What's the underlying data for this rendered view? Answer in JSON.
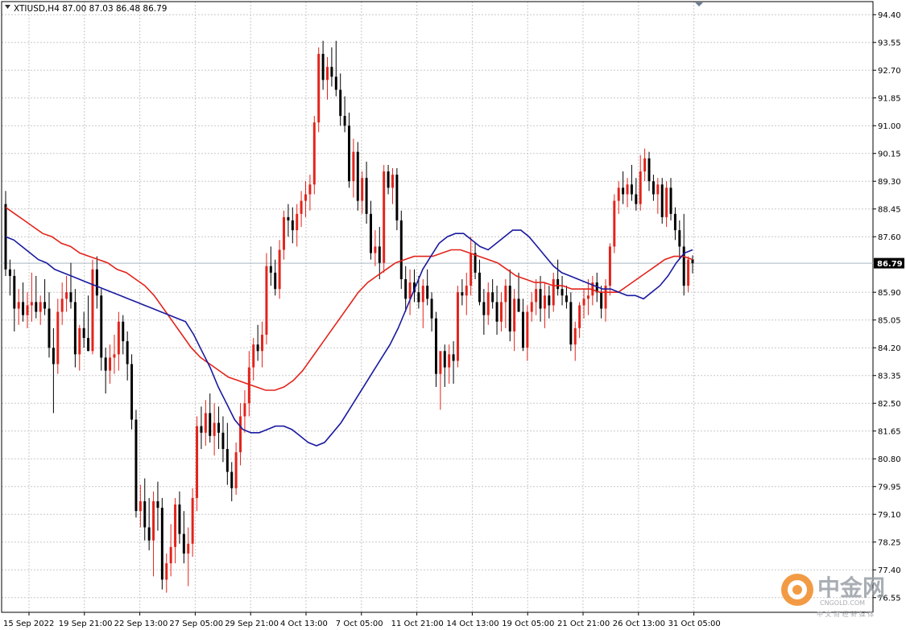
{
  "header": {
    "text": "XTIUSD,H4  87.00 87.03 86.48 86.79"
  },
  "price_tag": "86.79",
  "watermark": {
    "name": "中金网",
    "domain": "CNGOLD.COM",
    "tagline": "中 文 财 经 新 媒 体"
  },
  "colors": {
    "bull": "#e3231b",
    "bear": "#000000",
    "ma_fast": "#1a1aa0",
    "ma_slow": "#e3231b",
    "grid": "#c8c8c8",
    "price_line": "#aab8c2"
  },
  "chart_data": {
    "type": "candlestick",
    "symbol": "XTIUSD",
    "timeframe": "H4",
    "ylim": [
      76.1,
      94.8
    ],
    "y_ticks": [
      "94.40",
      "93.55",
      "92.70",
      "91.85",
      "91.00",
      "90.15",
      "89.30",
      "88.45",
      "87.60",
      "86.79",
      "85.90",
      "85.05",
      "84.20",
      "83.35",
      "82.50",
      "81.65",
      "80.80",
      "79.95",
      "79.10",
      "78.25",
      "77.40",
      "76.55"
    ],
    "x_labels": [
      "15 Sep 2022",
      "19 Sep 21:00",
      "22 Sep 13:00",
      "27 Sep 05:00",
      "29 Sep 21:00",
      "4 Oct 13:00",
      "7 Oct 05:00",
      "11 Oct 21:00",
      "14 Oct 13:00",
      "19 Oct 05:00",
      "21 Oct 21:00",
      "26 Oct 13:00",
      "31 Oct 05:00"
    ],
    "last_price": 86.79,
    "grid": true,
    "series": [
      {
        "name": "",
        "type": "candles",
        "ohlc": [
          [
            88.6,
            89.0,
            86.4,
            86.6
          ],
          [
            86.6,
            86.9,
            85.8,
            86.4
          ],
          [
            86.4,
            86.6,
            84.7,
            85.4
          ],
          [
            85.4,
            86.0,
            84.9,
            85.6
          ],
          [
            85.6,
            86.2,
            85.0,
            85.2
          ],
          [
            85.2,
            85.9,
            84.8,
            85.5
          ],
          [
            85.5,
            86.5,
            85.0,
            85.6
          ],
          [
            85.6,
            86.4,
            85.1,
            85.3
          ],
          [
            85.3,
            85.8,
            84.9,
            85.6
          ],
          [
            85.6,
            86.3,
            85.2,
            85.4
          ],
          [
            85.4,
            85.9,
            83.9,
            84.2
          ],
          [
            84.2,
            84.8,
            82.2,
            83.7
          ],
          [
            83.7,
            85.7,
            83.4,
            85.3
          ],
          [
            85.3,
            86.2,
            84.9,
            85.7
          ],
          [
            85.7,
            86.4,
            85.3,
            85.9
          ],
          [
            85.9,
            86.8,
            85.4,
            85.6
          ],
          [
            85.6,
            86.0,
            83.6,
            84.0
          ],
          [
            84.0,
            84.9,
            83.5,
            84.8
          ],
          [
            84.8,
            85.3,
            84.2,
            84.5
          ],
          [
            84.5,
            85.8,
            84.1,
            84.1
          ],
          [
            84.1,
            86.9,
            84.0,
            86.6
          ],
          [
            86.6,
            87.0,
            85.4,
            85.8
          ],
          [
            85.8,
            86.0,
            83.5,
            83.9
          ],
          [
            83.9,
            84.2,
            82.8,
            83.5
          ],
          [
            83.5,
            84.3,
            83.1,
            83.9
          ],
          [
            83.9,
            84.6,
            83.4,
            84.0
          ],
          [
            84.0,
            85.3,
            83.5,
            85.0
          ],
          [
            85.0,
            85.2,
            84.0,
            84.4
          ],
          [
            84.4,
            84.7,
            83.2,
            83.7
          ],
          [
            83.7,
            84.0,
            81.7,
            82.0
          ],
          [
            82.0,
            82.3,
            79.0,
            79.2
          ],
          [
            79.2,
            80.0,
            78.7,
            79.5
          ],
          [
            79.5,
            80.2,
            78.3,
            78.7
          ],
          [
            78.7,
            79.6,
            78.0,
            78.3
          ],
          [
            78.3,
            79.8,
            77.2,
            79.5
          ],
          [
            79.5,
            80.1,
            78.6,
            79.3
          ],
          [
            79.3,
            79.6,
            76.8,
            77.1
          ],
          [
            77.1,
            77.9,
            76.7,
            77.6
          ],
          [
            77.6,
            78.8,
            77.2,
            78.1
          ],
          [
            78.1,
            79.6,
            77.6,
            79.4
          ],
          [
            79.4,
            79.8,
            78.2,
            78.5
          ],
          [
            78.5,
            79.2,
            77.6,
            77.9
          ],
          [
            77.9,
            78.7,
            76.9,
            78.2
          ],
          [
            78.2,
            79.9,
            77.8,
            79.6
          ],
          [
            79.6,
            82.1,
            79.2,
            81.8
          ],
          [
            81.8,
            82.4,
            81.1,
            81.6
          ],
          [
            81.6,
            82.6,
            81.2,
            82.2
          ],
          [
            82.2,
            82.8,
            81.3,
            81.5
          ],
          [
            81.5,
            82.5,
            80.9,
            81.9
          ],
          [
            81.9,
            82.4,
            81.1,
            81.6
          ],
          [
            81.6,
            82.1,
            80.7,
            81.1
          ],
          [
            81.1,
            81.9,
            80.0,
            80.4
          ],
          [
            80.4,
            80.7,
            79.5,
            79.9
          ],
          [
            79.9,
            81.3,
            79.7,
            81.0
          ],
          [
            81.0,
            82.5,
            80.6,
            82.1
          ],
          [
            82.1,
            82.9,
            81.6,
            82.5
          ],
          [
            82.5,
            84.1,
            82.1,
            83.6
          ],
          [
            83.6,
            84.5,
            83.2,
            84.3
          ],
          [
            84.3,
            84.9,
            83.8,
            84.1
          ],
          [
            84.1,
            85.0,
            83.6,
            84.6
          ],
          [
            84.6,
            87.1,
            84.3,
            86.7
          ],
          [
            86.7,
            87.3,
            86.1,
            86.5
          ],
          [
            86.5,
            86.9,
            85.8,
            86.0
          ],
          [
            86.0,
            87.5,
            85.7,
            87.2
          ],
          [
            87.2,
            88.4,
            86.9,
            88.2
          ],
          [
            88.2,
            88.6,
            87.6,
            88.1
          ],
          [
            88.1,
            88.5,
            87.4,
            87.8
          ],
          [
            87.8,
            88.6,
            87.3,
            88.3
          ],
          [
            88.3,
            89.0,
            87.9,
            88.7
          ],
          [
            88.7,
            89.3,
            88.2,
            88.9
          ],
          [
            88.9,
            89.5,
            88.4,
            89.2
          ],
          [
            89.2,
            91.3,
            88.9,
            91.1
          ],
          [
            91.1,
            93.4,
            90.8,
            93.2
          ],
          [
            93.2,
            93.6,
            92.1,
            92.4
          ],
          [
            92.4,
            93.1,
            91.8,
            92.8
          ],
          [
            92.8,
            93.4,
            92.2,
            92.5
          ],
          [
            92.5,
            93.6,
            91.9,
            92.1
          ],
          [
            92.1,
            92.6,
            91.0,
            91.3
          ],
          [
            91.3,
            91.9,
            90.8,
            91.0
          ],
          [
            91.0,
            91.4,
            89.1,
            89.3
          ],
          [
            89.3,
            90.6,
            88.8,
            90.2
          ],
          [
            90.2,
            90.5,
            88.4,
            88.7
          ],
          [
            88.7,
            89.6,
            88.3,
            89.4
          ],
          [
            89.4,
            89.9,
            88.0,
            88.3
          ],
          [
            88.3,
            88.7,
            86.9,
            87.1
          ],
          [
            87.1,
            87.8,
            86.7,
            87.3
          ],
          [
            87.3,
            87.9,
            86.3,
            86.8
          ],
          [
            86.8,
            89.8,
            86.5,
            89.6
          ],
          [
            89.6,
            89.8,
            88.9,
            89.1
          ],
          [
            89.1,
            89.7,
            88.6,
            89.5
          ],
          [
            89.5,
            89.7,
            87.8,
            88.1
          ],
          [
            88.1,
            88.4,
            86.0,
            86.3
          ],
          [
            86.3,
            86.7,
            85.3,
            85.7
          ],
          [
            85.7,
            86.6,
            85.2,
            86.2
          ],
          [
            86.2,
            86.6,
            85.6,
            85.9
          ],
          [
            85.9,
            86.4,
            85.4,
            85.6
          ],
          [
            85.6,
            86.3,
            84.8,
            86.1
          ],
          [
            86.1,
            86.6,
            85.5,
            85.7
          ],
          [
            85.7,
            85.9,
            84.7,
            85.1
          ],
          [
            85.1,
            85.3,
            83.0,
            83.4
          ],
          [
            83.4,
            84.0,
            82.3,
            84.1
          ],
          [
            84.1,
            84.3,
            83.0,
            83.6
          ],
          [
            83.6,
            84.3,
            83.1,
            84.0
          ],
          [
            84.0,
            84.4,
            83.1,
            83.8
          ],
          [
            83.8,
            86.1,
            83.6,
            85.9
          ],
          [
            85.9,
            86.3,
            85.5,
            85.8
          ],
          [
            85.8,
            86.5,
            85.2,
            86.1
          ],
          [
            86.1,
            87.6,
            85.8,
            87.1
          ],
          [
            87.1,
            87.4,
            86.3,
            86.5
          ],
          [
            86.5,
            86.9,
            85.5,
            85.6
          ],
          [
            85.6,
            86.0,
            84.6,
            85.2
          ],
          [
            85.2,
            86.2,
            84.9,
            85.9
          ],
          [
            85.9,
            86.3,
            85.4,
            85.6
          ],
          [
            85.6,
            86.1,
            84.6,
            85.0
          ],
          [
            85.0,
            85.9,
            84.7,
            85.6
          ],
          [
            85.6,
            86.3,
            84.8,
            86.1
          ],
          [
            86.1,
            86.6,
            84.4,
            84.7
          ],
          [
            84.7,
            86.0,
            84.1,
            85.7
          ],
          [
            85.7,
            86.5,
            85.3,
            85.3
          ],
          [
            85.3,
            85.7,
            84.1,
            84.2
          ],
          [
            84.2,
            85.5,
            83.8,
            85.3
          ],
          [
            85.3,
            85.9,
            85.0,
            85.6
          ],
          [
            85.6,
            86.3,
            85.2,
            86.0
          ],
          [
            86.0,
            86.4,
            85.0,
            85.4
          ],
          [
            85.4,
            86.2,
            84.8,
            85.8
          ],
          [
            85.8,
            86.1,
            85.1,
            85.5
          ],
          [
            85.5,
            86.5,
            85.3,
            86.3
          ],
          [
            86.3,
            86.9,
            85.8,
            86.0
          ],
          [
            86.0,
            86.4,
            85.5,
            85.8
          ],
          [
            85.8,
            86.1,
            85.4,
            85.6
          ],
          [
            85.6,
            85.9,
            84.1,
            84.3
          ],
          [
            84.3,
            85.0,
            83.8,
            84.8
          ],
          [
            84.8,
            85.6,
            84.5,
            85.5
          ],
          [
            85.5,
            86.0,
            85.1,
            85.7
          ],
          [
            85.7,
            86.3,
            85.2,
            85.8
          ],
          [
            85.8,
            86.4,
            85.5,
            86.2
          ],
          [
            86.2,
            86.5,
            85.6,
            85.9
          ],
          [
            85.9,
            86.1,
            85.1,
            85.4
          ],
          [
            85.4,
            86.3,
            85.0,
            86.1
          ],
          [
            86.1,
            87.4,
            85.8,
            87.3
          ],
          [
            87.3,
            88.9,
            87.1,
            88.7
          ],
          [
            88.7,
            89.3,
            88.3,
            89.1
          ],
          [
            89.1,
            89.6,
            88.6,
            88.9
          ],
          [
            88.9,
            89.4,
            88.5,
            89.2
          ],
          [
            89.2,
            89.8,
            88.7,
            88.9
          ],
          [
            88.9,
            89.4,
            88.4,
            88.6
          ],
          [
            88.6,
            90.1,
            88.4,
            89.6
          ],
          [
            89.6,
            90.3,
            89.3,
            90.0
          ],
          [
            90.0,
            90.2,
            89.0,
            89.3
          ],
          [
            89.3,
            89.5,
            88.7,
            88.9
          ],
          [
            88.9,
            89.4,
            88.3,
            89.2
          ],
          [
            89.2,
            89.4,
            88.0,
            88.2
          ],
          [
            88.2,
            89.3,
            87.9,
            89.1
          ],
          [
            89.1,
            89.4,
            88.1,
            88.3
          ],
          [
            88.3,
            88.5,
            87.5,
            87.8
          ],
          [
            87.8,
            88.1,
            86.9,
            87.3
          ],
          [
            87.3,
            88.3,
            85.8,
            86.1
          ],
          [
            86.1,
            87.0,
            85.9,
            86.9
          ],
          [
            86.9,
            87.03,
            86.48,
            86.79
          ]
        ]
      },
      {
        "name": "",
        "type": "line",
        "values": [
          87.6,
          87.5,
          87.3,
          87.1,
          86.9,
          86.8,
          86.6,
          86.5,
          86.4,
          86.3,
          86.2,
          86.1,
          86.0,
          85.9,
          85.8,
          85.7,
          85.6,
          85.5,
          85.4,
          85.3,
          85.2,
          85.1,
          85.0,
          84.6,
          84.1,
          83.6,
          83.0,
          82.5,
          82.0,
          81.7,
          81.6,
          81.6,
          81.7,
          81.8,
          81.8,
          81.7,
          81.5,
          81.3,
          81.2,
          81.3,
          81.6,
          81.9,
          82.3,
          82.7,
          83.1,
          83.5,
          83.9,
          84.3,
          84.8,
          85.4,
          86.0,
          86.6,
          87.0,
          87.4,
          87.6,
          87.7,
          87.7,
          87.5,
          87.3,
          87.2,
          87.4,
          87.6,
          87.8,
          87.8,
          87.6,
          87.3,
          87.0,
          86.7,
          86.5,
          86.4,
          86.3,
          86.2,
          86.1,
          86.0,
          86.0,
          85.9,
          85.8,
          85.8,
          85.7,
          85.9,
          86.1,
          86.4,
          86.8,
          87.1,
          87.2
        ]
      },
      {
        "name": "",
        "type": "line",
        "values": [
          88.5,
          88.3,
          88.1,
          87.9,
          87.7,
          87.6,
          87.4,
          87.3,
          87.1,
          87.0,
          86.9,
          86.8,
          86.6,
          86.5,
          86.3,
          86.1,
          85.8,
          85.4,
          85.0,
          84.6,
          84.2,
          83.9,
          83.7,
          83.5,
          83.3,
          83.2,
          83.1,
          83.0,
          82.9,
          82.9,
          83.0,
          83.2,
          83.5,
          83.9,
          84.3,
          84.7,
          85.1,
          85.5,
          85.9,
          86.2,
          86.4,
          86.6,
          86.8,
          86.9,
          87.0,
          87.0,
          87.0,
          87.1,
          87.2,
          87.2,
          87.1,
          87.0,
          86.9,
          86.8,
          86.6,
          86.4,
          86.3,
          86.2,
          86.2,
          86.1,
          86.1,
          86.0,
          86.0,
          86.0,
          85.9,
          85.9,
          85.9,
          86.1,
          86.3,
          86.5,
          86.7,
          86.9,
          87.0,
          87.0,
          86.9
        ]
      }
    ]
  }
}
